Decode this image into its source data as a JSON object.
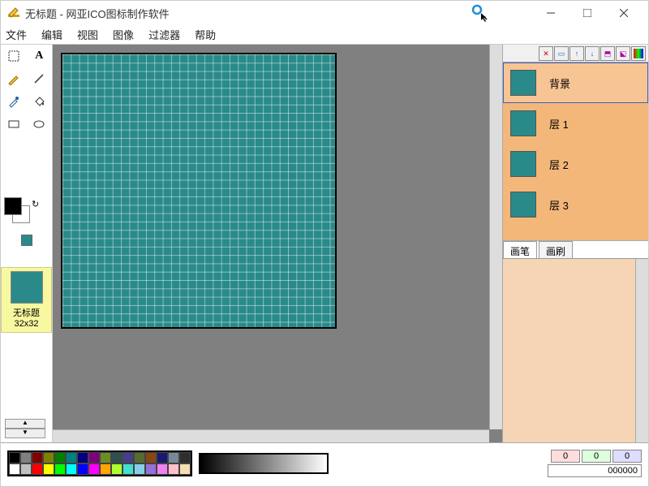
{
  "title": "无标题 - 网亚ICO图标制作软件",
  "menu": [
    "文件",
    "编辑",
    "视图",
    "图像",
    "过滤器",
    "帮助"
  ],
  "thumb": {
    "label1": "无标题",
    "label2": "32x32"
  },
  "layers": {
    "items": [
      {
        "name": "背景",
        "selected": true
      },
      {
        "name": "层 1",
        "selected": false
      },
      {
        "name": "层 2",
        "selected": false
      },
      {
        "name": "层 3",
        "selected": false
      }
    ]
  },
  "brush_tabs": {
    "tab1": "画笔",
    "tab2": "画刷"
  },
  "rgb": {
    "r": "0",
    "g": "0",
    "b": "0",
    "hex": "000000"
  },
  "palette": [
    "#000000",
    "#808080",
    "#800000",
    "#808000",
    "#008000",
    "#008080",
    "#000080",
    "#800080",
    "#6b8e23",
    "#2f4f4f",
    "#483d8b",
    "#556b2f",
    "#8b4513",
    "#191970",
    "#778899",
    "#2e2e2e",
    "#ffffff",
    "#c0c0c0",
    "#ff0000",
    "#ffff00",
    "#00ff00",
    "#00ffff",
    "#0000ff",
    "#ff00ff",
    "#ffa500",
    "#adff2f",
    "#40e0d0",
    "#87ceeb",
    "#9370db",
    "#ee82ee",
    "#ffc0cb",
    "#f5deb3"
  ]
}
